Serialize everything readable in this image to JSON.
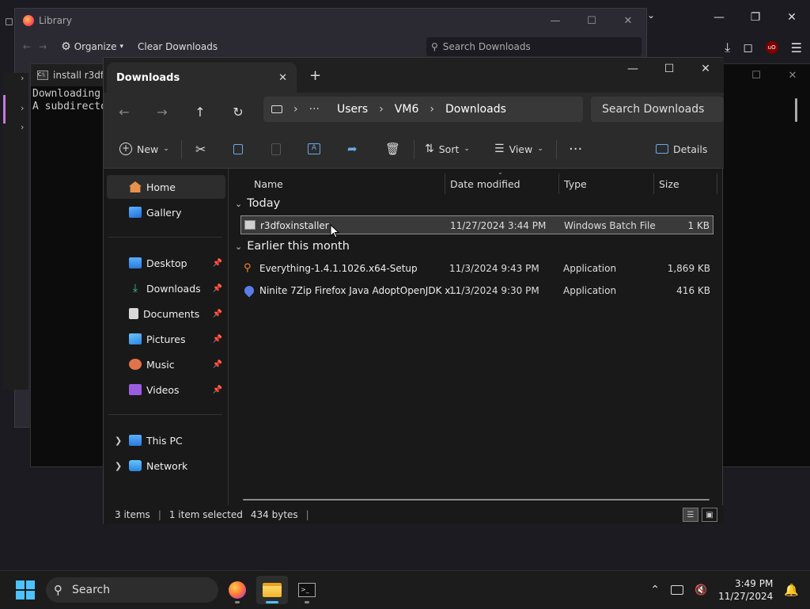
{
  "library": {
    "title": "Library",
    "organize": "Organize",
    "clear_downloads": "Clear Downloads",
    "search_placeholder": "Search Downloads"
  },
  "terminal": {
    "tab_title": "install r3dfo",
    "line1": "Downloading",
    "line2": "A subdirecto"
  },
  "explorer": {
    "tab_title": "Downloads",
    "breadcrumb": [
      "Users",
      "VM6",
      "Downloads"
    ],
    "search_placeholder": "Search Downloads",
    "commands": {
      "new": "New",
      "sort": "Sort",
      "view": "View",
      "details": "Details"
    },
    "nav": {
      "home": "Home",
      "gallery": "Gallery",
      "desktop": "Desktop",
      "downloads": "Downloads",
      "documents": "Documents",
      "pictures": "Pictures",
      "music": "Music",
      "videos": "Videos",
      "this_pc": "This PC",
      "network": "Network"
    },
    "columns": {
      "name": "Name",
      "date": "Date modified",
      "type": "Type",
      "size": "Size"
    },
    "groups": {
      "today": "Today",
      "earlier": "Earlier this month"
    },
    "files": [
      {
        "name": "r3dfoxinstaller",
        "date": "11/27/2024 3:44 PM",
        "type": "Windows Batch File",
        "size": "1 KB"
      },
      {
        "name": "Everything-1.4.1.1026.x64-Setup",
        "date": "11/3/2024 9:43 PM",
        "type": "Application",
        "size": "1,869 KB"
      },
      {
        "name": "Ninite 7Zip Firefox Java AdoptOpenJDK x...",
        "date": "11/3/2024 9:30 PM",
        "type": "Application",
        "size": "416 KB"
      }
    ],
    "status": {
      "items": "3 items",
      "selected": "1 item selected",
      "bytes": "434 bytes"
    }
  },
  "taskbar": {
    "search_placeholder": "Search",
    "time": "3:49 PM",
    "date": "11/27/2024"
  },
  "colors": {
    "accent": "#4cc2ff",
    "selection": "#3a3a3a"
  }
}
